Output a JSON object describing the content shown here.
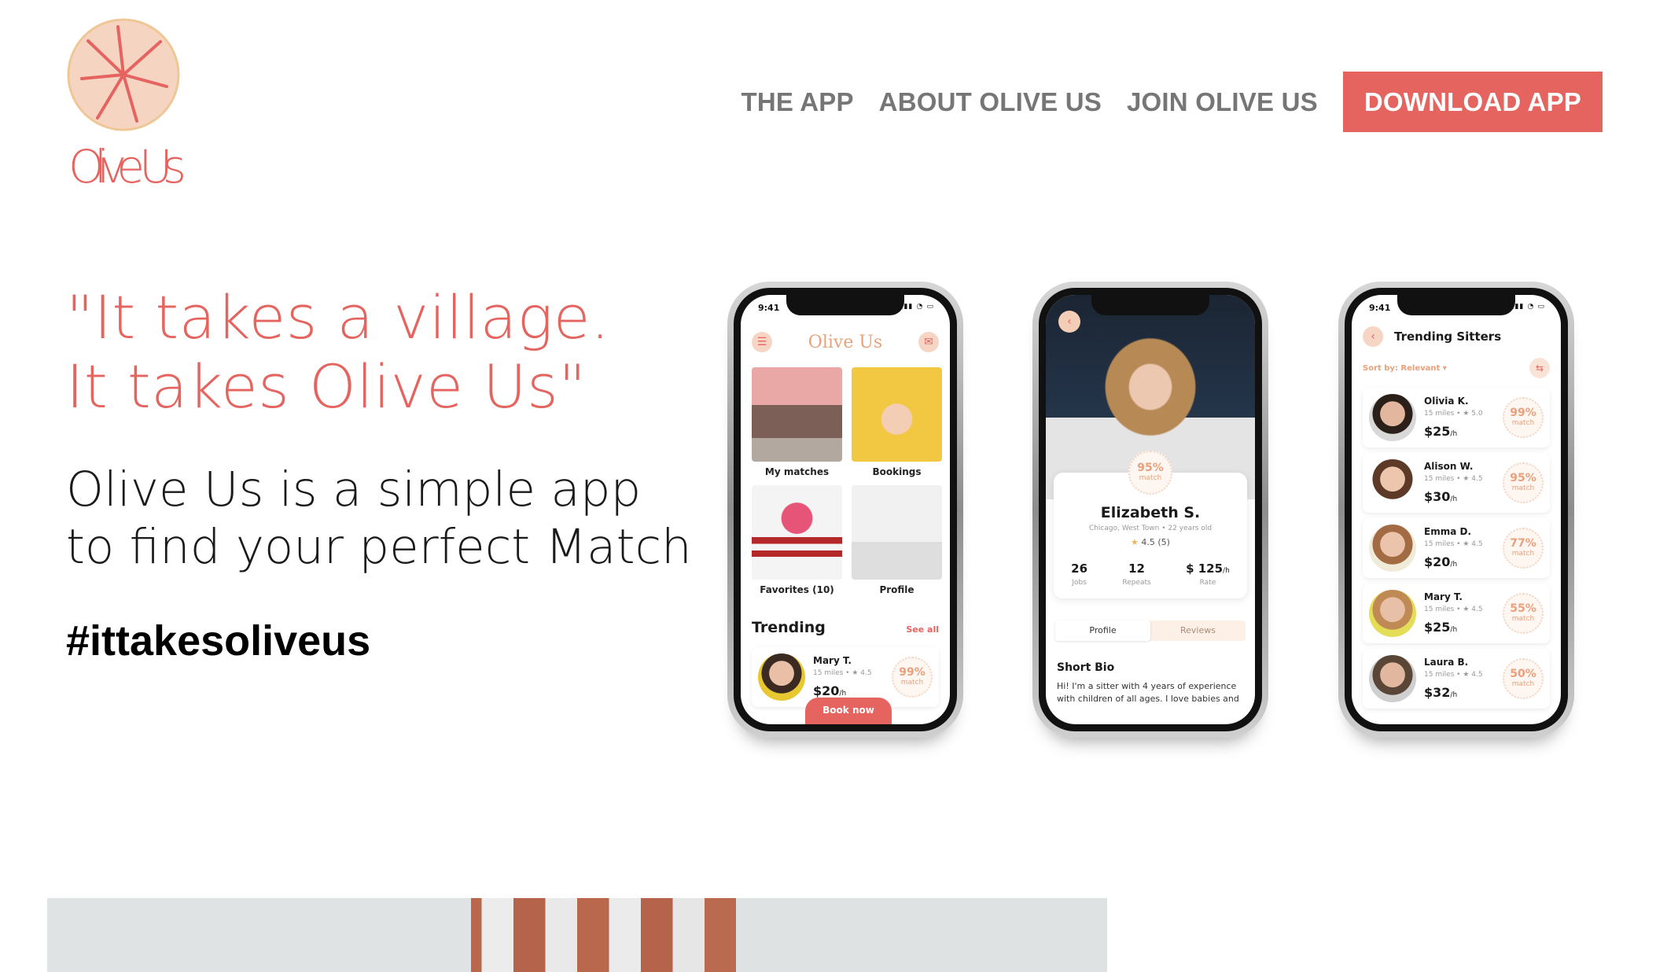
{
  "brand": {
    "name": "Olive Us"
  },
  "nav": {
    "items": [
      "THE APP",
      "ABOUT OLIVE US",
      "JOIN OLIVE US"
    ],
    "download_label": "DOWNLOAD APP"
  },
  "hero": {
    "quote": "\"It takes a village. It takes Olive Us\"",
    "tagline": "Olive Us is a simple app to find your perfect Match",
    "hashtag": "#ittakesoliveus"
  },
  "colors": {
    "accent": "#e6645f",
    "nav_text": "#767676",
    "logo_fill": "#f5d4c1"
  },
  "phone_home": {
    "time": "9:41",
    "brand": "Olive Us",
    "tiles": [
      "My matches",
      "Bookings",
      "Favorites (10)",
      "Profile"
    ],
    "trending_title": "Trending",
    "see_all": "See all",
    "card": {
      "name": "Mary T.",
      "meta": "15 miles • ★ 4.5",
      "price": "$20",
      "unit": "/h",
      "match": "99%",
      "match_label": "match"
    },
    "book_now": "Book now"
  },
  "phone_profile": {
    "match": "95%",
    "match_label": "match",
    "name": "Elizabeth S.",
    "location": "Chicago, West Town • 22 years old",
    "rating": "4.5 (5)",
    "stats": [
      {
        "value": "26",
        "unit": "",
        "label": "Jobs"
      },
      {
        "value": "12",
        "unit": "",
        "label": "Repeats"
      },
      {
        "value": "$ 125",
        "unit": "/h",
        "label": "Rate"
      }
    ],
    "tabs": [
      "Profile",
      "Reviews"
    ],
    "bio_title": "Short Bio",
    "bio": "Hi! I'm a sitter with 4 years of experience with children of all ages. I love babies and"
  },
  "phone_list": {
    "time": "9:41",
    "title": "Trending Sitters",
    "sort": "Sort by: Relevant ▾",
    "sitters": [
      {
        "name": "Olivia K.",
        "meta": "15 miles • ★ 5.0",
        "price": "$25",
        "unit": "/h",
        "match": "99%",
        "match_label": "match"
      },
      {
        "name": "Alison W.",
        "meta": "15 miles • ★ 4.5",
        "price": "$30",
        "unit": "/h",
        "match": "95%",
        "match_label": "match"
      },
      {
        "name": "Emma D.",
        "meta": "15 miles • ★ 4.5",
        "price": "$20",
        "unit": "/h",
        "match": "77%",
        "match_label": "match"
      },
      {
        "name": "Mary T.",
        "meta": "15 miles • ★ 4.5",
        "price": "$25",
        "unit": "/h",
        "match": "55%",
        "match_label": "match"
      },
      {
        "name": "Laura B.",
        "meta": "15 miles • ★ 4.5",
        "price": "$32",
        "unit": "/h",
        "match": "50%",
        "match_label": "match"
      }
    ]
  }
}
